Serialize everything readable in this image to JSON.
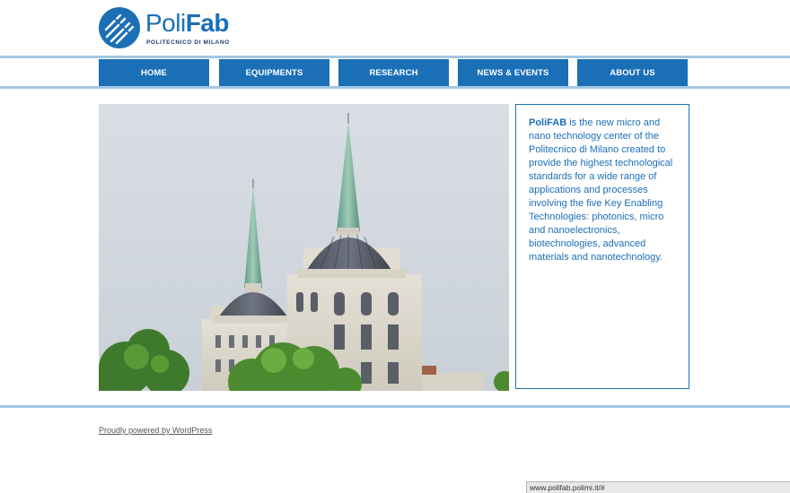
{
  "brand": {
    "logo_text_light": "Poli",
    "logo_text_bold": "Fab",
    "logo_subtitle": "POLITECNICO DI MILANO",
    "color": "#1b6fb7"
  },
  "nav": {
    "items": [
      {
        "label": "HOME",
        "active": true
      },
      {
        "label": "EQUIPMENTS",
        "active": false
      },
      {
        "label": "RESEARCH",
        "active": false
      },
      {
        "label": "NEWS & EVENTS",
        "active": false
      },
      {
        "label": "ABOUT US",
        "active": false
      }
    ]
  },
  "hero": {
    "image_icon": "building-photo"
  },
  "intro": {
    "brand_name": "PoliFAB",
    "text": " is the new micro and nano technology center of the Politecnico di Milano created to provide the highest technological standards for a wide range of applications and processes involving the five Key Enabling Technologies: photonics, micro and nanoelectronics, biotechnologies, advanced materials and nanotechnology."
  },
  "footer": {
    "credit_link": "Proudly powered by WordPress"
  },
  "status_bar": {
    "url": "www.polifab.polimi.it/#"
  }
}
